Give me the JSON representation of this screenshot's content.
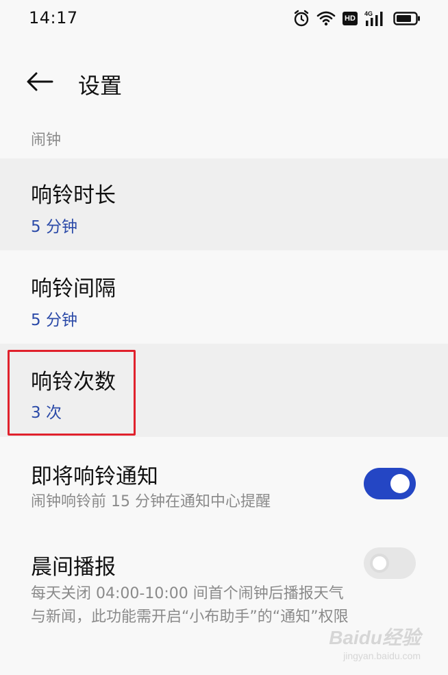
{
  "status_bar": {
    "time": "14:17",
    "icons": [
      "alarm-icon",
      "wifi-icon",
      "hd-icon",
      "signal-4g-icon",
      "battery-icon"
    ],
    "hd_label": "HD",
    "network_label": "4G"
  },
  "header": {
    "title": "设置",
    "back_icon": "back-arrow-icon"
  },
  "section": {
    "label": "闹钟"
  },
  "settings": [
    {
      "title": "响铃时长",
      "value": "5 分钟"
    },
    {
      "title": "响铃间隔",
      "value": "5 分钟"
    },
    {
      "title": "响铃次数",
      "value": "3 次"
    }
  ],
  "toggles": [
    {
      "title": "即将响铃通知",
      "desc": "闹钟响铃前 15 分钟在通知中心提醒",
      "enabled": true
    },
    {
      "title": "晨间播报",
      "desc": "每天关闭 04:00-10:00 间首个闹钟后播报天气与新闻，此功能需开启“小布助手”的“通知”权限",
      "enabled": false
    }
  ],
  "watermark": {
    "main": "Baidu经验",
    "sub": "jingyan.baidu.com"
  },
  "colors": {
    "accent": "#2446c4",
    "value_text": "#2b4aa8",
    "highlight": "#e0212c",
    "background": "#f8f8f8",
    "row_shade": "#efefef"
  }
}
